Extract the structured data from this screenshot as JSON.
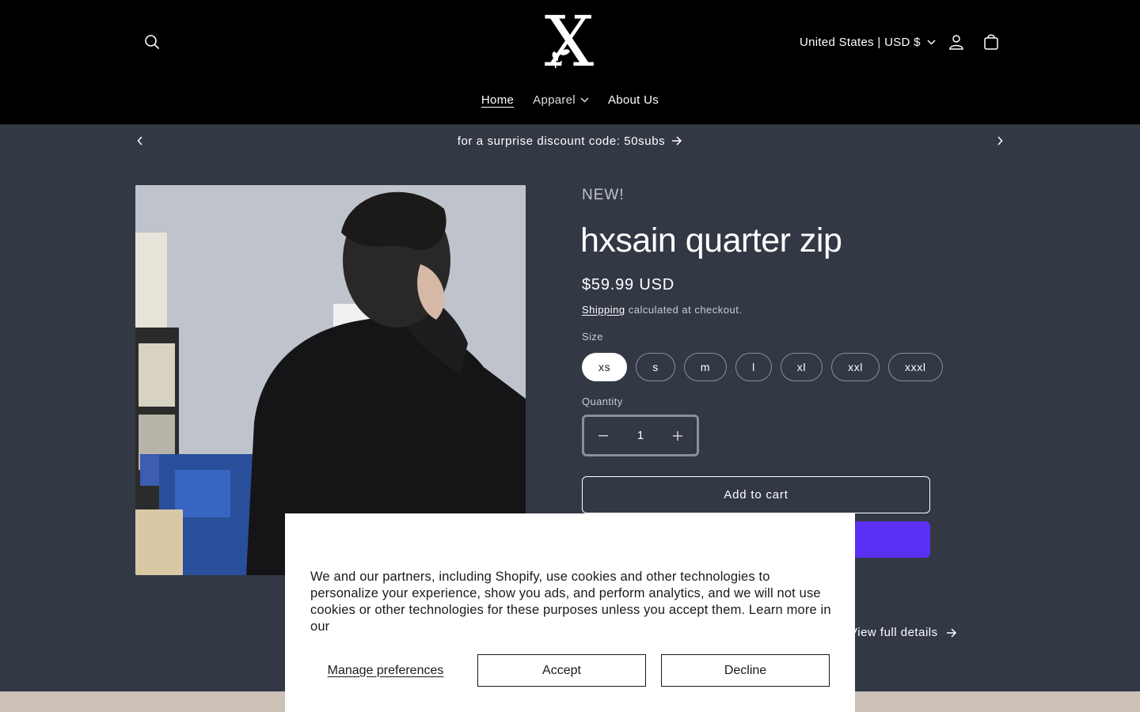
{
  "header": {
    "logo_letter": "X",
    "currency_label": "United States | USD $",
    "icons": {
      "search": "search-icon",
      "account": "account-icon",
      "cart": "cart-icon",
      "currency_chevron": "chevron-down-icon"
    }
  },
  "nav": {
    "items": [
      {
        "label": "Home",
        "active": true
      },
      {
        "label": "Apparel",
        "has_dropdown": true
      },
      {
        "label": "About Us"
      }
    ]
  },
  "announcement": {
    "text": "for a surprise discount code: 50subs"
  },
  "product": {
    "badge": "NEW!",
    "title": "hxsain quarter zip",
    "price": "$59.99 USD",
    "shipping_link": "Shipping",
    "shipping_suffix": " calculated at checkout.",
    "size_label": "Size",
    "sizes": [
      "xs",
      "s",
      "m",
      "l",
      "xl",
      "xxl",
      "xxxl"
    ],
    "selected_size": "xs",
    "quantity_label": "Quantity",
    "quantity_value": "1",
    "add_to_cart_label": "Add to cart",
    "buy_now_color": "#5a31f4",
    "view_details_label": "View full details"
  },
  "cookie_banner": {
    "text": "We and our partners, including Shopify, use cookies and other technologies to personalize your experience, show you ads, and perform analytics, and we will not use cookies or other technologies for these purposes unless you accept them. Learn more in our",
    "manage_label": "Manage preferences",
    "accept_label": "Accept",
    "decline_label": "Decline"
  },
  "colors": {
    "header_bg": "#000000",
    "page_bg": "#323844",
    "footer_strip": "#cbc1b6"
  }
}
